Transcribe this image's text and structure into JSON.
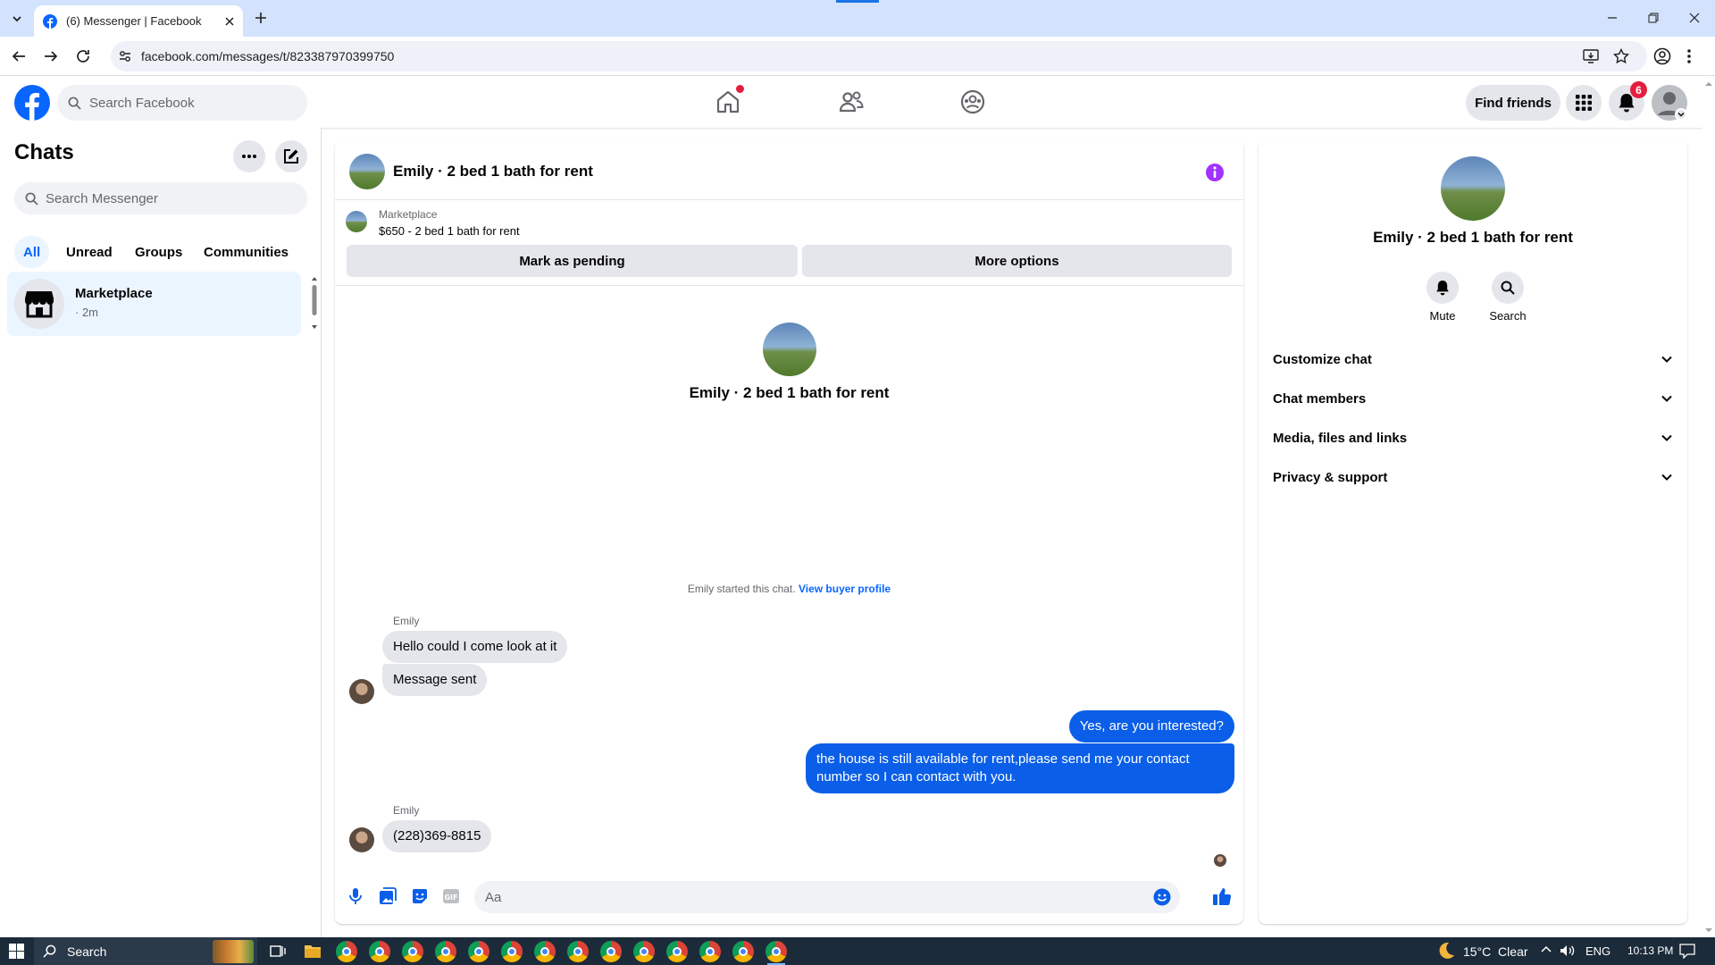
{
  "browser": {
    "tab_title": "(6) Messenger | Facebook",
    "url": "facebook.com/messages/t/823387970399750"
  },
  "header": {
    "search_placeholder": "Search Facebook",
    "find_friends": "Find friends",
    "notification_count": "6"
  },
  "sidebar": {
    "title": "Chats",
    "search_placeholder": "Search Messenger",
    "filters": [
      "All",
      "Unread",
      "Groups",
      "Communities"
    ],
    "chat": {
      "name": "Marketplace",
      "time": "· 2m"
    }
  },
  "conversation": {
    "title": "Emily · 2 bed 1 bath for rent",
    "listing_source": "Marketplace",
    "listing_title": "$650 - 2 bed 1 bath for rent",
    "mark_pending": "Mark as pending",
    "more_options": "More options",
    "intro_name": "Emily · 2 bed 1 bath for rent",
    "started_text": "Emily started this chat.",
    "view_buyer": "View buyer profile",
    "messages": [
      {
        "sender": "Emily",
        "text": "Hello could I come look at it",
        "dir": "in"
      },
      {
        "sender": "",
        "text": "Message sent",
        "dir": "in"
      },
      {
        "sender": "",
        "text": "Yes, are you interested?",
        "dir": "out"
      },
      {
        "sender": "",
        "text": "the house is still available for rent,please send me your contact number so I can contact with you.",
        "dir": "out"
      },
      {
        "sender": "Emily",
        "text": "(228)369-8815",
        "dir": "in"
      }
    ],
    "composer_placeholder": "Aa",
    "accent": "#0a7cff"
  },
  "info_panel": {
    "name": "Emily · 2 bed 1 bath for rent",
    "mute": "Mute",
    "search": "Search",
    "sections": [
      "Customize chat",
      "Chat members",
      "Media, files and links",
      "Privacy & support"
    ]
  },
  "taskbar": {
    "search": "Search",
    "weather": "15°C  Clear",
    "lang": "ENG",
    "time": "10:13 PM"
  }
}
